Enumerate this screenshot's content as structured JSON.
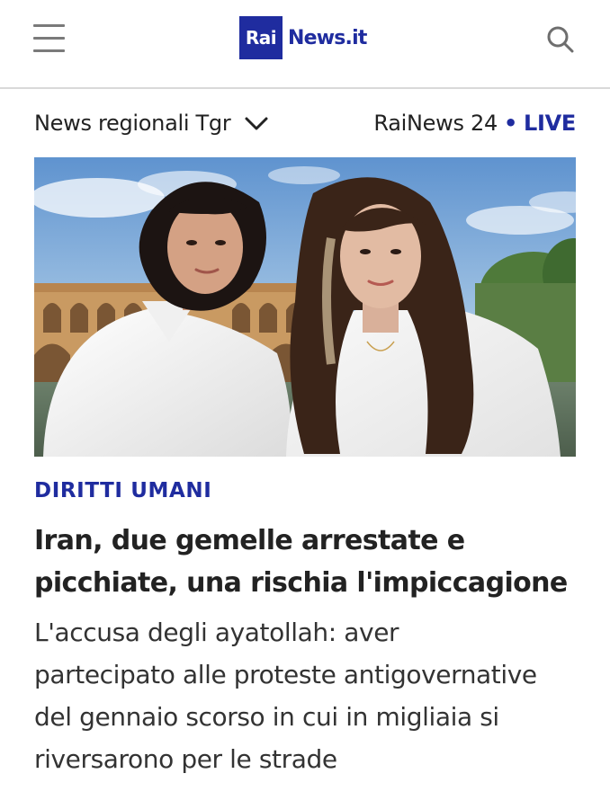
{
  "header": {
    "logo_mark": "Rai",
    "logo_text": "News.it",
    "brand_color": "#1f2c9f",
    "menu_icon": "hamburger-menu-icon",
    "search_icon": "search-icon"
  },
  "subnav": {
    "regional_label": "News regionali Tgr",
    "regional_icon": "chevron-down-icon",
    "live_channel": "RaiNews 24",
    "live_separator": "•",
    "live_label": "LIVE"
  },
  "article": {
    "image_description": "two women in white shirts in front of a historic arched bridge",
    "category": "DIRITTI UMANI",
    "headline": "Iran, due gemelle arrestate e picchiate, una rischia l'impiccagione",
    "summary": "L'accusa degli ayatollah: aver partecipato alle proteste antigovernative del gennaio scorso in cui in migliaia si riversarono per le strade"
  }
}
